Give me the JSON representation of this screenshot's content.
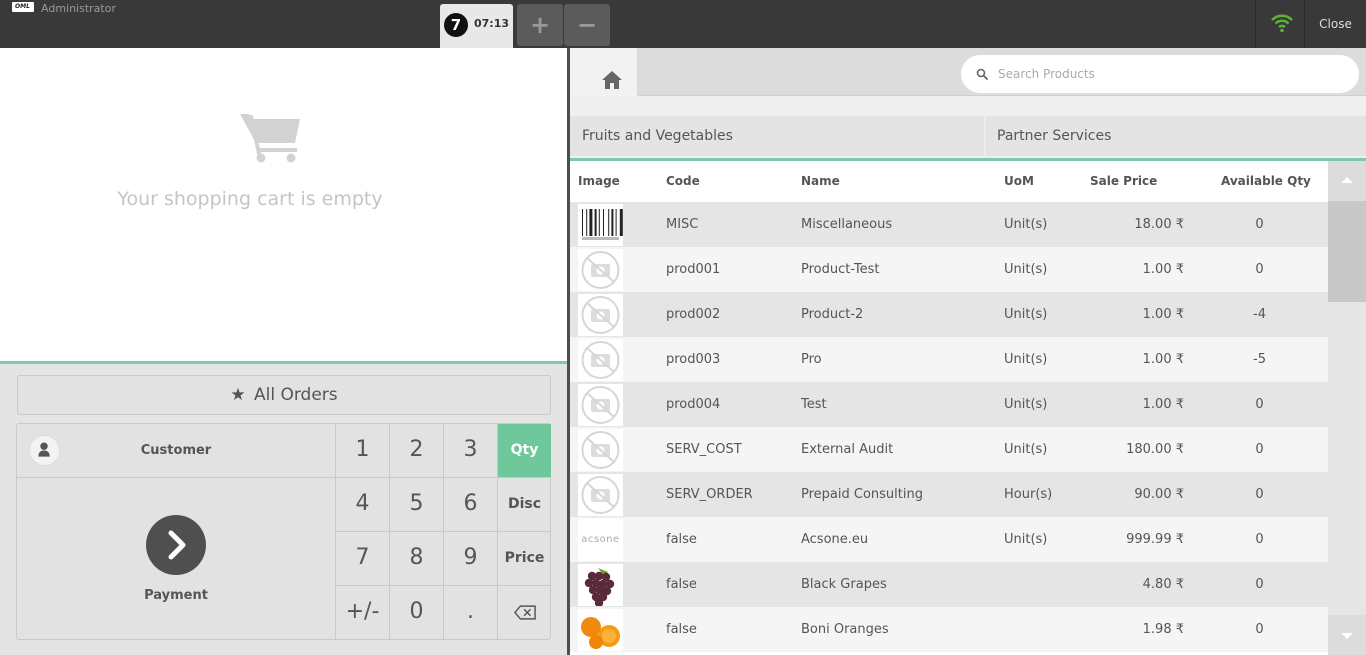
{
  "topbar": {
    "logo_text": "OML",
    "user": "Administrator",
    "order": {
      "number": "7",
      "time": "07:13"
    },
    "add_label": "+",
    "remove_label": "−",
    "close_label": "Close"
  },
  "cart": {
    "empty_text": "Your shopping cart is empty"
  },
  "actions": {
    "all_orders": "All Orders",
    "customer": "Customer",
    "payment": "Payment"
  },
  "numpad": {
    "keys": [
      "1",
      "2",
      "3",
      "4",
      "5",
      "6",
      "7",
      "8",
      "9",
      "+/-",
      "0",
      "."
    ],
    "qty": "Qty",
    "disc": "Disc",
    "price": "Price",
    "active_mode": "Qty"
  },
  "search": {
    "placeholder": "Search Products"
  },
  "categories": [
    "Fruits and Vegetables",
    "Partner Services"
  ],
  "products": {
    "headers": [
      "Image",
      "Code",
      "Name",
      "UoM",
      "Sale Price",
      "Available Qty"
    ],
    "rows": [
      {
        "image": "barcode",
        "code": "MISC",
        "name": "Miscellaneous",
        "uom": "Unit(s)",
        "price": "18.00 ₹",
        "qty": "0"
      },
      {
        "image": "no-image",
        "code": "prod001",
        "name": "Product-Test",
        "uom": "Unit(s)",
        "price": "1.00 ₹",
        "qty": "0"
      },
      {
        "image": "no-image",
        "code": "prod002",
        "name": "Product-2",
        "uom": "Unit(s)",
        "price": "1.00 ₹",
        "qty": "-4"
      },
      {
        "image": "no-image",
        "code": "prod003",
        "name": "Pro",
        "uom": "Unit(s)",
        "price": "1.00 ₹",
        "qty": "-5"
      },
      {
        "image": "no-image",
        "code": "prod004",
        "name": "Test",
        "uom": "Unit(s)",
        "price": "1.00 ₹",
        "qty": "0"
      },
      {
        "image": "no-image",
        "code": "SERV_COST",
        "name": "External Audit",
        "uom": "Unit(s)",
        "price": "180.00 ₹",
        "qty": "0"
      },
      {
        "image": "no-image",
        "code": "SERV_ORDER",
        "name": "Prepaid Consulting",
        "uom": "Hour(s)",
        "price": "90.00 ₹",
        "qty": "0"
      },
      {
        "image": "acsone-logo",
        "image_text": "acsone",
        "code": "false",
        "name": "Acsone.eu",
        "uom": "Unit(s)",
        "price": "999.99 ₹",
        "qty": "0"
      },
      {
        "image": "grapes",
        "code": "false",
        "name": "Black Grapes",
        "uom": "",
        "price": "4.80 ₹",
        "qty": "0"
      },
      {
        "image": "oranges",
        "code": "false",
        "name": "Boni Oranges",
        "uom": "",
        "price": "1.98 ₹",
        "qty": "0"
      }
    ]
  },
  "colors": {
    "topbar": "#393939",
    "accent_green": "#6ec89b",
    "divider_green": "#7fc9a9"
  }
}
